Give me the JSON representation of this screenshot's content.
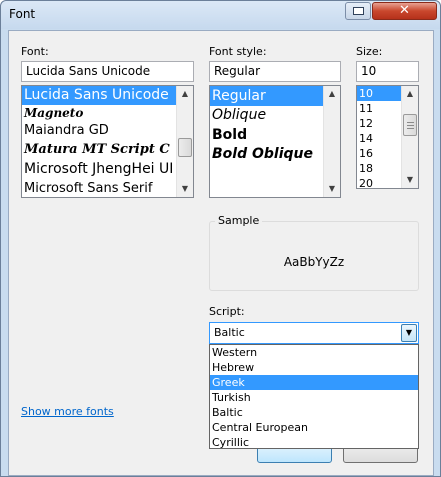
{
  "window": {
    "title": "Font",
    "close_label": "✕"
  },
  "font": {
    "label": "Font:",
    "value": "Lucida Sans Unicode",
    "items": [
      "Lucida Sans Unicode",
      "Magneto",
      "Maiandra GD",
      "Matura MT Script C",
      "Microsoft JhengHei UI",
      "Microsoft Sans Serif"
    ]
  },
  "style": {
    "label": "Font style:",
    "value": "Regular",
    "items": [
      "Regular",
      "Oblique",
      "Bold",
      "Bold Oblique"
    ]
  },
  "size": {
    "label": "Size:",
    "value": "10",
    "items": [
      "10",
      "11",
      "12",
      "14",
      "16",
      "18",
      "20"
    ]
  },
  "sample": {
    "legend": "Sample",
    "text": "AaBbYyZz"
  },
  "script": {
    "label": "Script:",
    "value": "Baltic",
    "options": [
      "Western",
      "Hebrew",
      "Greek",
      "Turkish",
      "Baltic",
      "Central European",
      "Cyrillic"
    ],
    "highlighted": "Greek"
  },
  "show_more_fonts": "Show more fonts",
  "buttons": {
    "ok": "",
    "cancel": ""
  }
}
